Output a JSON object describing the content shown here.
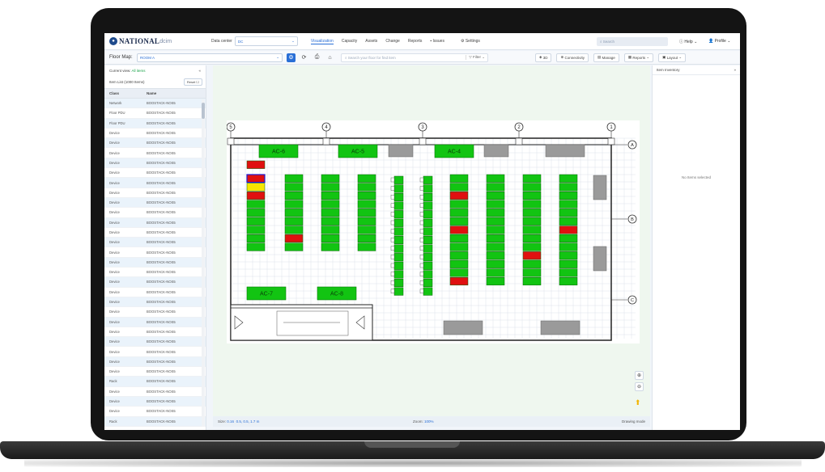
{
  "topnav": {
    "logo_main": "NATIONAL",
    "logo_sub": "dcim",
    "datacenter_label": "Data center",
    "datacenter_value": "DC",
    "links": [
      "Visualization",
      "Capacity",
      "Assets",
      "Change",
      "Reports",
      "Issues",
      "Settings"
    ],
    "active_link": "Visualization",
    "search_placeholder": "Search",
    "help_label": "Help",
    "user_label": "Profile"
  },
  "toolbar": {
    "floor_map_label": "Floor Map:",
    "room_value": "ROOM A",
    "fp_search_placeholder": "Search your floor for find item",
    "filter_label": "Filter",
    "btn_3d": "3D",
    "btn_connectivity": "Connectivity",
    "btn_manage": "Manage",
    "btn_reports": "Reports",
    "btn_layout": "Layout"
  },
  "leftpanel": {
    "current_view_label": "Current view:",
    "current_view_value": "All items",
    "item_list_label": "Item List (1000 Items)",
    "reset_label": "Reset",
    "col_class": "Class",
    "col_name": "Name",
    "rows": [
      {
        "cls": "Network",
        "name": "BOOSTACK-NOS5"
      },
      {
        "cls": "Floor PDU",
        "name": "BOOSTACK-NOS5"
      },
      {
        "cls": "Floor PDU",
        "name": "BOOSTACK-NOS5"
      },
      {
        "cls": "Device",
        "name": "BOOSTACK-NOS5"
      },
      {
        "cls": "Device",
        "name": "BOOSTACK-NOS5"
      },
      {
        "cls": "Device",
        "name": "BOOSTACK-NOS5"
      },
      {
        "cls": "Device",
        "name": "BOOSTACK-NOS5"
      },
      {
        "cls": "Device",
        "name": "BOOSTACK-NOS5"
      },
      {
        "cls": "Device",
        "name": "BOOSTACK-NOS5"
      },
      {
        "cls": "Device",
        "name": "BOOSTACK-NOS5"
      },
      {
        "cls": "Device",
        "name": "BOOSTACK-NOS5"
      },
      {
        "cls": "Device",
        "name": "BOOSTACK-NOS5"
      },
      {
        "cls": "Device",
        "name": "BOOSTACK-NOS5"
      },
      {
        "cls": "Device",
        "name": "BOOSTACK-NOS5"
      },
      {
        "cls": "Device",
        "name": "BOOSTACK-NOS5"
      },
      {
        "cls": "Device",
        "name": "BOOSTACK-NOS5"
      },
      {
        "cls": "Device",
        "name": "BOOSTACK-NOS5"
      },
      {
        "cls": "Device",
        "name": "BOOSTACK-NOS5"
      },
      {
        "cls": "Device",
        "name": "BOOSTACK-NOS5"
      },
      {
        "cls": "Device",
        "name": "BOOSTACK-NOS5"
      },
      {
        "cls": "Device",
        "name": "BOOSTACK-NOS5"
      },
      {
        "cls": "Device",
        "name": "BOOSTACK-NOS5"
      },
      {
        "cls": "Device",
        "name": "BOOSTACK-NOS5"
      },
      {
        "cls": "Device",
        "name": "BOOSTACK-NOS5"
      },
      {
        "cls": "Device",
        "name": "BOOSTACK-NOS5"
      },
      {
        "cls": "Device",
        "name": "BOOSTACK-NOS5"
      },
      {
        "cls": "Device",
        "name": "BOOSTACK-NOS5"
      },
      {
        "cls": "Device",
        "name": "BOOSTACK-NOS5"
      },
      {
        "cls": "Rack",
        "name": "BOOSTACK-NOS5"
      },
      {
        "cls": "Device",
        "name": "BOOSTACK-NOS5"
      },
      {
        "cls": "Device",
        "name": "BOOSTACK-NOS5"
      },
      {
        "cls": "Device",
        "name": "BOOSTACK-NOS5"
      },
      {
        "cls": "Rack",
        "name": "BOOSTACK-NOS5"
      }
    ]
  },
  "floor": {
    "ac_labels": [
      "AC-6",
      "AC-5",
      "AC-4",
      "AC-7",
      "AC-8"
    ],
    "column_markers": [
      "5",
      "4",
      "3",
      "2",
      "1"
    ],
    "row_markers": [
      "A",
      "B",
      "C"
    ],
    "colors": {
      "ok": "#12c412",
      "alarm": "#e01010",
      "warn": "#f7e600",
      "grey": "#9a9a9a"
    }
  },
  "statusbar": {
    "size_label": "Size:",
    "size_value": "0.16",
    "coords_value": "0.5, 0.5, 1.7 m",
    "zoom_label": "Zoom:",
    "zoom_value": "100%",
    "mode_label": "Drawing mode"
  },
  "rightpanel": {
    "title": "Item Inventory",
    "empty_text": "No Items selected"
  }
}
